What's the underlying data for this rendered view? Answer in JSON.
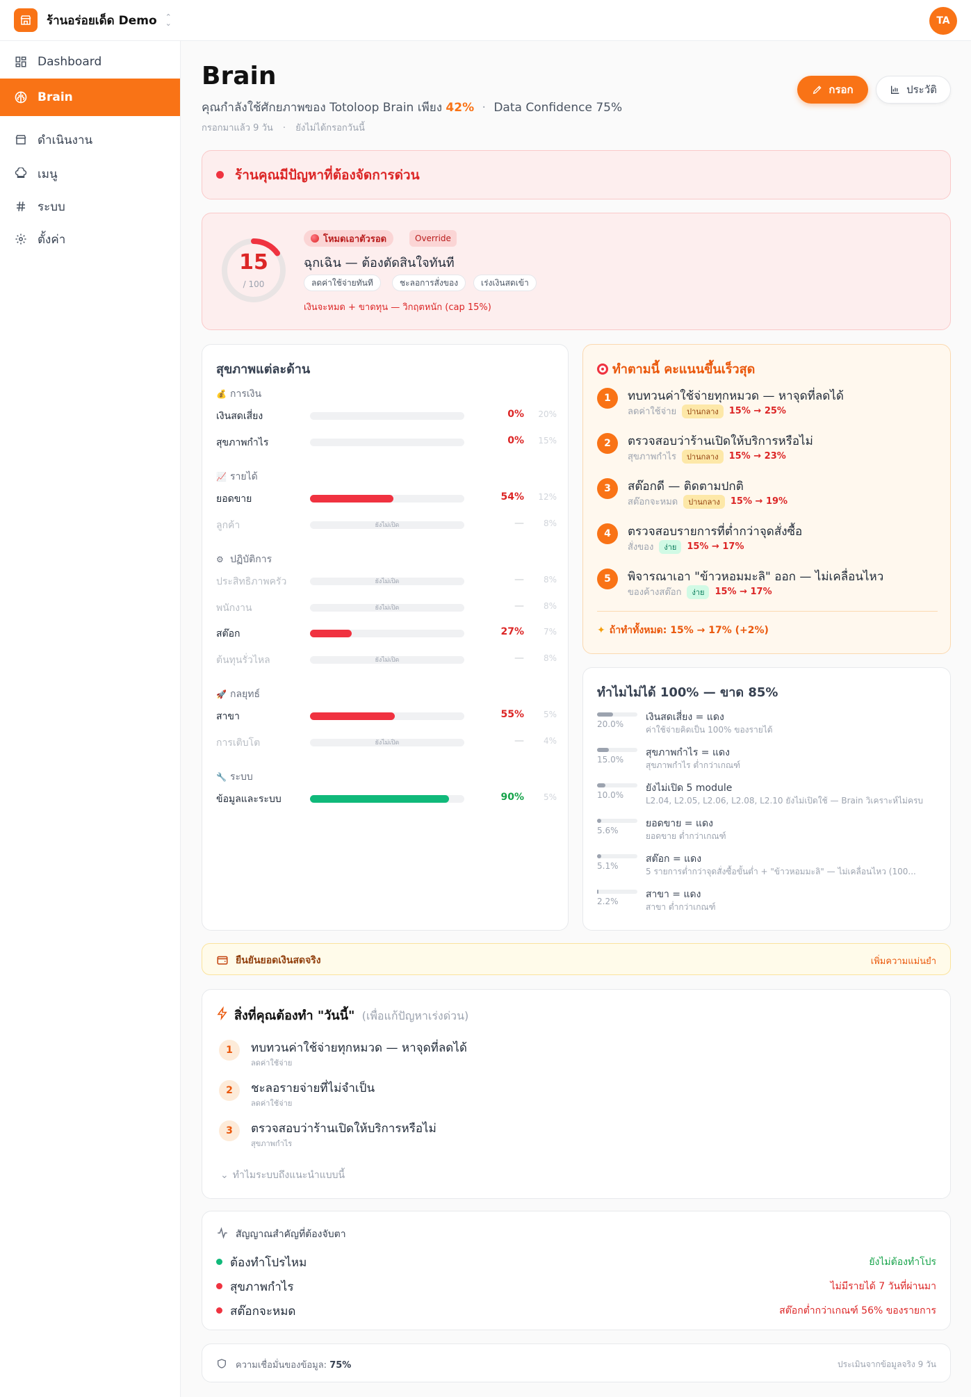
{
  "colors": {
    "accent": "#f97316",
    "danger": "#dc2626",
    "success": "#16a34a",
    "bar_red": "#f03240",
    "bar_green": "#10b97a"
  },
  "topbar": {
    "store_name": "ร้านอร่อยเด็ด Demo",
    "avatar": "TA"
  },
  "sidebar": {
    "items": [
      {
        "label": "Dashboard",
        "icon": "grid-icon"
      },
      {
        "label": "Brain",
        "icon": "brain-icon",
        "active": true
      },
      {
        "label": "ดำเนินงาน",
        "icon": "store-icon"
      },
      {
        "label": "เมนู",
        "icon": "chef-hat-icon"
      },
      {
        "label": "ระบบ",
        "icon": "hash-icon"
      },
      {
        "label": "ตั้งค่า",
        "icon": "gear-icon"
      }
    ]
  },
  "header": {
    "title": "Brain",
    "subtitle_prefix": "คุณกำลังใช้ศักยภาพของ Totoloop Brain เพียง",
    "subtitle_pct": "42%",
    "subtitle_sep": "·",
    "confidence": "Data Confidence 75%",
    "meta_days": "กรอกมาแล้ว 9 วัน",
    "meta_sep": "·",
    "meta_today": "ยังไม่ได้กรอกวันนี้",
    "fill_button": "กรอก",
    "history_button": "ประวัติ"
  },
  "alert": {
    "text": "ร้านคุณมีปัญหาที่ต้องจัดการด่วน"
  },
  "survival": {
    "score": "15",
    "score_of": "/ 100",
    "score_value": 15,
    "mode": "โหมดเอาตัวรอด",
    "override": "Override",
    "title": "ฉุกเฉิน — ต้องตัดสินใจทันที",
    "chips": [
      "ลดค่าใช้จ่ายทันที",
      "ชะลอการสั่งของ",
      "เร่งเงินสดเข้า"
    ],
    "note": "เงินจะหมด + ขาดทุน — วิกฤตหนัก (cap 15%)"
  },
  "health": {
    "title": "สุขภาพแต่ละด้าน",
    "closed_label": "ยังไม่เปิด",
    "groups": [
      {
        "icon": "money-bag-icon",
        "label": "การเงิน",
        "rows": [
          {
            "label": "เงินสดเสี่ยง",
            "value": "0%",
            "pct": 0,
            "weight": "20%",
            "color": "red",
            "off": false
          },
          {
            "label": "สุขภาพกำไร",
            "value": "0%",
            "pct": 0,
            "weight": "15%",
            "color": "red",
            "off": false
          }
        ]
      },
      {
        "icon": "chart-up-icon",
        "label": "รายได้",
        "rows": [
          {
            "label": "ยอดขาย",
            "value": "54%",
            "pct": 54,
            "weight": "12%",
            "color": "red",
            "off": false
          },
          {
            "label": "ลูกค้า",
            "value": "—",
            "pct": 0,
            "weight": "8%",
            "color": "gray",
            "off": true
          }
        ]
      },
      {
        "icon": "gear-icon",
        "label": "ปฏิบัติการ",
        "rows": [
          {
            "label": "ประสิทธิภาพครัว",
            "value": "—",
            "pct": 0,
            "weight": "8%",
            "color": "gray",
            "off": true
          },
          {
            "label": "พนักงาน",
            "value": "—",
            "pct": 0,
            "weight": "8%",
            "color": "gray",
            "off": true
          },
          {
            "label": "สต๊อก",
            "value": "27%",
            "pct": 27,
            "weight": "7%",
            "color": "red",
            "off": false
          },
          {
            "label": "ต้นทุนรั่วไหล",
            "value": "—",
            "pct": 0,
            "weight": "8%",
            "color": "gray",
            "off": true
          }
        ]
      },
      {
        "icon": "rocket-icon",
        "label": "กลยุทธ์",
        "rows": [
          {
            "label": "สาขา",
            "value": "55%",
            "pct": 55,
            "weight": "5%",
            "color": "red",
            "off": false
          },
          {
            "label": "การเติบโต",
            "value": "—",
            "pct": 0,
            "weight": "4%",
            "color": "gray",
            "off": true
          }
        ]
      },
      {
        "icon": "wrench-icon",
        "label": "ระบบ",
        "rows": [
          {
            "label": "ข้อมูลและระบบ",
            "value": "90%",
            "pct": 90,
            "weight": "5%",
            "color": "green",
            "off": false
          }
        ]
      }
    ]
  },
  "quick": {
    "title": "ทำตามนี้ คะแนนขึ้นเร็วสุด",
    "steps": [
      {
        "num": "1",
        "title": "ทบทวนค่าใช้จ่ายทุกหมวด — หาจุดที่ลดได้",
        "cat": "ลดค่าใช้จ่าย",
        "diff": "ปานกลาง",
        "level": "mid",
        "gain": "15% → 25%"
      },
      {
        "num": "2",
        "title": "ตรวจสอบว่าร้านเปิดให้บริการหรือไม่",
        "cat": "สุขภาพกำไร",
        "diff": "ปานกลาง",
        "level": "mid",
        "gain": "15% → 23%"
      },
      {
        "num": "3",
        "title": "สต๊อกดี — ติดตามปกติ",
        "cat": "สต๊อกจะหมด",
        "diff": "ปานกลาง",
        "level": "mid",
        "gain": "15% → 19%"
      },
      {
        "num": "4",
        "title": "ตรวจสอบรายการที่ต่ำกว่าจุดสั่งซื้อ",
        "cat": "สั่งของ",
        "diff": "ง่าย",
        "level": "easy",
        "gain": "15% → 17%"
      },
      {
        "num": "5",
        "title": "พิจารณาเอา \"ข้าวหอมมะลิ\" ออก — ไม่เคลื่อนไหว",
        "cat": "ของค้างสต๊อก",
        "diff": "ง่าย",
        "level": "easy",
        "gain": "15% → 17%"
      }
    ],
    "total": "ถ้าทำทั้งหมด: 15% → 17% (+2%)"
  },
  "why": {
    "title": "ทำไมไม่ได้ 100% — ขาด 85%",
    "rows": [
      {
        "pct": "20.0%",
        "share": 0.4,
        "title": "เงินสดเสี่ยง = แดง",
        "desc": "ค่าใช้จ่ายคิดเป็น 100% ของรายได้"
      },
      {
        "pct": "15.0%",
        "share": 0.3,
        "title": "สุขภาพกำไร = แดง",
        "desc": "สุขภาพกำไร ต่ำกว่าเกณฑ์"
      },
      {
        "pct": "10.0%",
        "share": 0.2,
        "title": "ยังไม่เปิด 5 module",
        "desc": "L2.04, L2.05, L2.06, L2.08, L2.10 ยังไม่เปิดใช้ — Brain วิเคราะห์ไม่ครบ"
      },
      {
        "pct": "5.6%",
        "share": 0.11,
        "title": "ยอดขาย = แดง",
        "desc": "ยอดขาย ต่ำกว่าเกณฑ์"
      },
      {
        "pct": "5.1%",
        "share": 0.1,
        "title": "สต๊อก = แดง",
        "desc": "5 รายการต่ำกว่าจุดสั่งซื้อขั้นต่ำ + \"ข้าวหอมมะลิ\" — ไม่เคลื่อนไหว (100..."
      },
      {
        "pct": "2.2%",
        "share": 0.04,
        "title": "สาขา = แดง",
        "desc": "สาขา ต่ำกว่าเกณฑ์"
      }
    ]
  },
  "cash": {
    "label": "ยืนยันยอดเงินสดจริง",
    "action": "เพิ่มความแม่นยำ"
  },
  "today": {
    "title": "สิ่งที่คุณต้องทำ \"วันนี้\"",
    "title_note": "(เพื่อแก้ปัญหาเร่งด่วน)",
    "items": [
      {
        "num": "1",
        "title": "ทบทวนค่าใช้จ่ายทุกหมวด — หาจุดที่ลดได้",
        "sub": "ลดค่าใช้จ่าย"
      },
      {
        "num": "2",
        "title": "ชะลอรายจ่ายที่ไม่จำเป็น",
        "sub": "ลดค่าใช้จ่าย"
      },
      {
        "num": "3",
        "title": "ตรวจสอบว่าร้านเปิดให้บริการหรือไม่",
        "sub": "สุขภาพกำไร"
      }
    ],
    "why_link": "ทำไมระบบถึงแนะนำแบบนี้"
  },
  "signals": {
    "title": "สัญญาณสำคัญที่ต้องจับตา",
    "rows": [
      {
        "name": "ต้องทำโปรไหม",
        "status": "ยังไม่ต้องทำโปร",
        "color": "#16a34a",
        "dot": "#10b97a"
      },
      {
        "name": "สุขภาพกำไร",
        "status": "ไม่มีรายได้ 7 วันที่ผ่านมา",
        "color": "#dc2626",
        "dot": "#ef3340"
      },
      {
        "name": "สต๊อกจะหมด",
        "status": "สต๊อกต่ำกว่าเกณฑ์ 56% ของรายการ",
        "color": "#dc2626",
        "dot": "#ef3340"
      }
    ]
  },
  "footer": {
    "label": "ความเชื่อมั่นของข้อมูล:",
    "value": "75%",
    "right": "ประเมินจากข้อมูลจริง 9 วัน"
  }
}
